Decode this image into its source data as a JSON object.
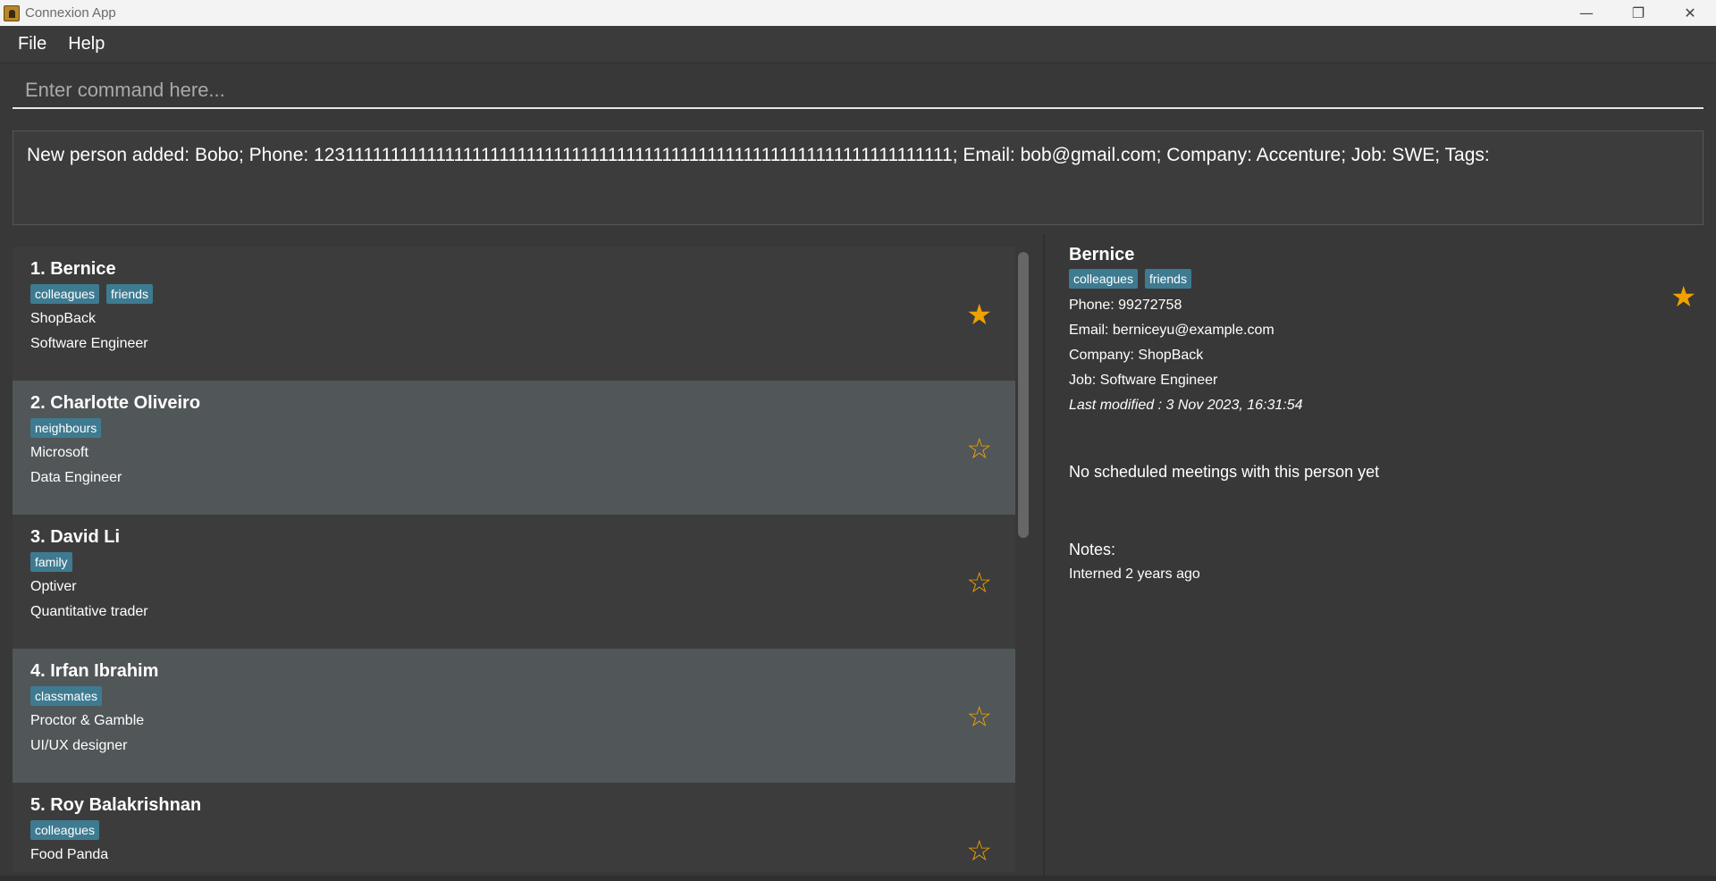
{
  "window": {
    "title": "Connexion App",
    "minimize": "—",
    "restore": "❐",
    "close": "✕"
  },
  "menu": {
    "file": "File",
    "help": "Help"
  },
  "command": {
    "placeholder": "Enter command here...",
    "value": ""
  },
  "result": {
    "text": "New person added: Bobo; Phone: 1231111111111111111111111111111111111111111111111111111111111111111111; Email: bob@gmail.com; Company: Accenture; Job: SWE; Tags:"
  },
  "colors": {
    "accent_star": "#f0a100",
    "tag_bg": "#3e7b91",
    "row_alt": "#515658"
  },
  "persons": [
    {
      "name": "1.  Bernice",
      "tags": [
        "colleagues",
        "friends"
      ],
      "company": "ShopBack",
      "job": "Software Engineer",
      "favourite": true
    },
    {
      "name": "2.  Charlotte Oliveiro",
      "tags": [
        "neighbours"
      ],
      "company": "Microsoft",
      "job": "Data Engineer",
      "favourite": false
    },
    {
      "name": "3.  David Li",
      "tags": [
        "family"
      ],
      "company": "Optiver",
      "job": "Quantitative trader",
      "favourite": false
    },
    {
      "name": "4.  Irfan Ibrahim",
      "tags": [
        "classmates"
      ],
      "company": "Proctor & Gamble",
      "job": "UI/UX designer",
      "favourite": false
    },
    {
      "name": "5.  Roy Balakrishnan",
      "tags": [
        "colleagues"
      ],
      "company": "Food Panda",
      "job": "",
      "favourite": false
    }
  ],
  "star_icons": {
    "filled": "★",
    "outline": "☆"
  },
  "detail": {
    "name": "Bernice",
    "tags": [
      "colleagues",
      "friends"
    ],
    "phone": "Phone: 99272758",
    "email": "Email: berniceyu@example.com",
    "company": "Company: ShopBack",
    "job": "Job: Software Engineer",
    "last_modified": "Last modified : 3 Nov 2023, 16:31:54",
    "meetings": "No scheduled meetings with this person yet",
    "notes_label": "Notes:",
    "notes": "Interned 2 years ago",
    "favourite": true
  }
}
